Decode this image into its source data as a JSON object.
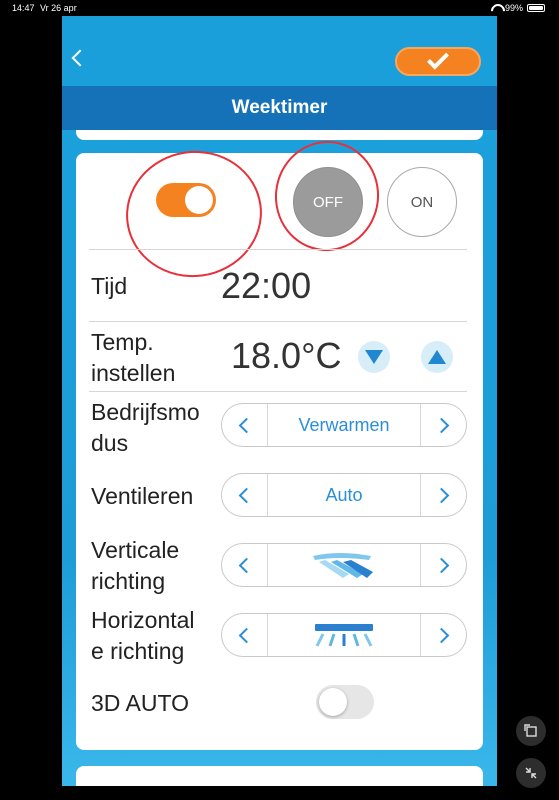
{
  "status": {
    "time": "14:47",
    "date": "Vr 26 apr",
    "battery": "99%"
  },
  "header": {
    "title": "Weektimer"
  },
  "power": {
    "off_label": "OFF",
    "on_label": "ON"
  },
  "time": {
    "label": "Tijd",
    "value": "22:00"
  },
  "temperature": {
    "label": "Temp.\ninstellen",
    "value": "18.0°C"
  },
  "mode": {
    "label": "Bedrijfsmo\ndus",
    "value": "Verwarmen"
  },
  "fan": {
    "label": "Ventileren",
    "value": "Auto"
  },
  "vertical": {
    "label": "Verticale\nrichting"
  },
  "horizontal": {
    "label": "Horizontal\ne richting"
  },
  "auto3d": {
    "label": "3D AUTO"
  }
}
